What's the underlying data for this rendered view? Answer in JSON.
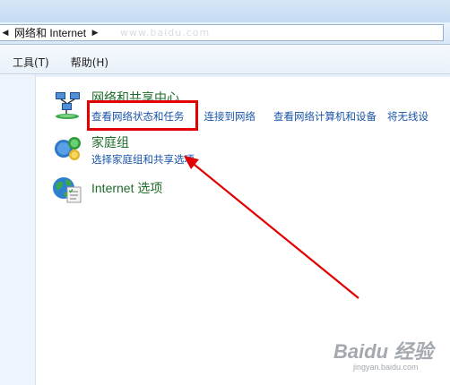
{
  "address_bar": {
    "crumb": "网络和 Internet",
    "ghost_text": "www.baidu.com"
  },
  "menu": {
    "items": [
      "工具(T)",
      "帮助(H)"
    ]
  },
  "categories": [
    {
      "title": "网络和共享中心",
      "icon": "network-sharing-center-icon",
      "links": [
        "查看网络状态和任务",
        "连接到网络",
        "查看网络计算机和设备",
        "将无线设"
      ]
    },
    {
      "title": "家庭组",
      "icon": "homegroup-icon",
      "links": [
        "选择家庭组和共享选项"
      ]
    },
    {
      "title": "Internet 选项",
      "icon": "internet-options-icon",
      "links": []
    }
  ],
  "annotation": {
    "box_color": "#e20000",
    "arrow_color": "#e20000"
  },
  "watermark": {
    "text": "Baidu 经验",
    "sub": "jingyan.baidu.com"
  }
}
